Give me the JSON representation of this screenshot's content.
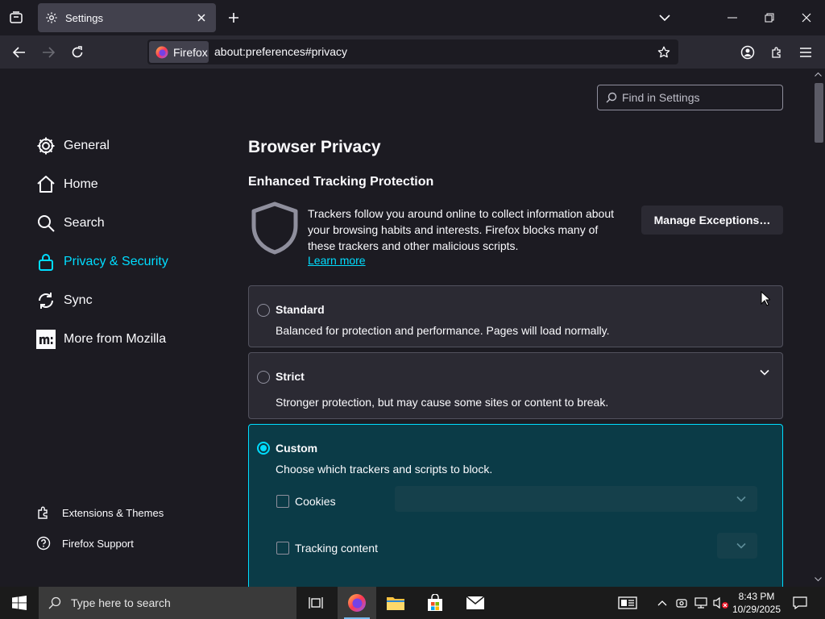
{
  "window": {
    "tab_title": "Settings"
  },
  "navbar": {
    "identity_label": "Firefox",
    "url": "about:preferences#privacy"
  },
  "search": {
    "placeholder": "Find in Settings"
  },
  "sidebar": {
    "categories": [
      {
        "label": "General",
        "icon": "gear-icon"
      },
      {
        "label": "Home",
        "icon": "home-icon"
      },
      {
        "label": "Search",
        "icon": "search-icon"
      },
      {
        "label": "Privacy & Security",
        "icon": "lock-icon",
        "selected": true
      },
      {
        "label": "Sync",
        "icon": "sync-icon"
      },
      {
        "label": "More from Mozilla",
        "icon": "mozilla-icon"
      }
    ],
    "footer": [
      {
        "label": "Extensions & Themes",
        "icon": "puzzle-icon"
      },
      {
        "label": "Firefox Support",
        "icon": "help-icon"
      }
    ]
  },
  "main": {
    "title": "Browser Privacy",
    "etp": {
      "heading": "Enhanced Tracking Protection",
      "description": "Trackers follow you around online to collect information about your browsing habits and interests. Firefox blocks many of these trackers and other malicious scripts.",
      "learn_more": "Learn more",
      "manage_button": "Manage Exceptions…"
    },
    "options": [
      {
        "title": "Standard",
        "description": "Balanced for protection and performance. Pages will load normally.",
        "selected": false
      },
      {
        "title": "Strict",
        "description": "Stronger protection, but may cause some sites or content to break.",
        "selected": false
      },
      {
        "title": "Custom",
        "description": "Choose which trackers and scripts to block.",
        "selected": true
      }
    ],
    "custom_items": [
      {
        "label": "Cookies",
        "checked": false
      },
      {
        "label": "Tracking content",
        "checked": false
      }
    ]
  },
  "taskbar": {
    "search_placeholder": "Type here to search",
    "time": "8:43 PM",
    "date": "10/29/2025"
  },
  "colors": {
    "accent": "#00ddff",
    "background": "#1c1b22",
    "card": "#2b2a33"
  }
}
